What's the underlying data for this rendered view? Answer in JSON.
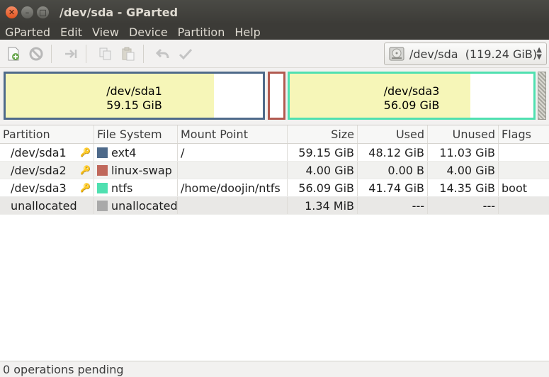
{
  "window": {
    "title": "/dev/sda - GParted",
    "close_glyph": "✕",
    "min_glyph": "–",
    "max_glyph": "□"
  },
  "menu": [
    "GParted",
    "Edit",
    "View",
    "Device",
    "Partition",
    "Help"
  ],
  "toolbar": {
    "icons": [
      "new-partition-icon",
      "delete-icon",
      "resize-move-icon",
      "copy-icon",
      "paste-icon",
      "undo-icon",
      "apply-icon"
    ],
    "device": "/dev/sda  (119.24 GiB)"
  },
  "diskmap": [
    {
      "name": "/dev/sda1",
      "size": "59.15 GiB",
      "used_fraction": 0.81,
      "color": "#4e6a8a"
    },
    {
      "name": "/dev/sda2",
      "size": "",
      "used_fraction": 0,
      "color": "#b15a50"
    },
    {
      "name": "/dev/sda3",
      "size": "56.09 GiB",
      "used_fraction": 0.74,
      "color": "#4fe0b0"
    }
  ],
  "table": {
    "headers": [
      "Partition",
      "File System",
      "Mount Point",
      "Size",
      "Used",
      "Unused",
      "Flags"
    ],
    "rows": [
      {
        "partition": "/dev/sda1",
        "fs": "ext4",
        "fs_color": "#4e6a8a",
        "mount": "/",
        "size": "59.15 GiB",
        "used": "48.12 GiB",
        "unused": "11.03 GiB",
        "flags": ""
      },
      {
        "partition": "/dev/sda2",
        "fs": "linux-swap",
        "fs_color": "#c0685b",
        "mount": "",
        "size": "4.00 GiB",
        "used": "0.00 B",
        "unused": "4.00 GiB",
        "flags": ""
      },
      {
        "partition": "/dev/sda3",
        "fs": "ntfs",
        "fs_color": "#4fe0b0",
        "mount": "/home/doojin/ntfs",
        "size": "56.09 GiB",
        "used": "41.74 GiB",
        "unused": "14.35 GiB",
        "flags": "boot"
      },
      {
        "partition": "unallocated",
        "fs": "unallocated",
        "fs_color": "#a9a9a9",
        "mount": "",
        "size": "1.34 MiB",
        "used": "---",
        "unused": "---",
        "flags": ""
      }
    ]
  },
  "status": "0 operations pending"
}
